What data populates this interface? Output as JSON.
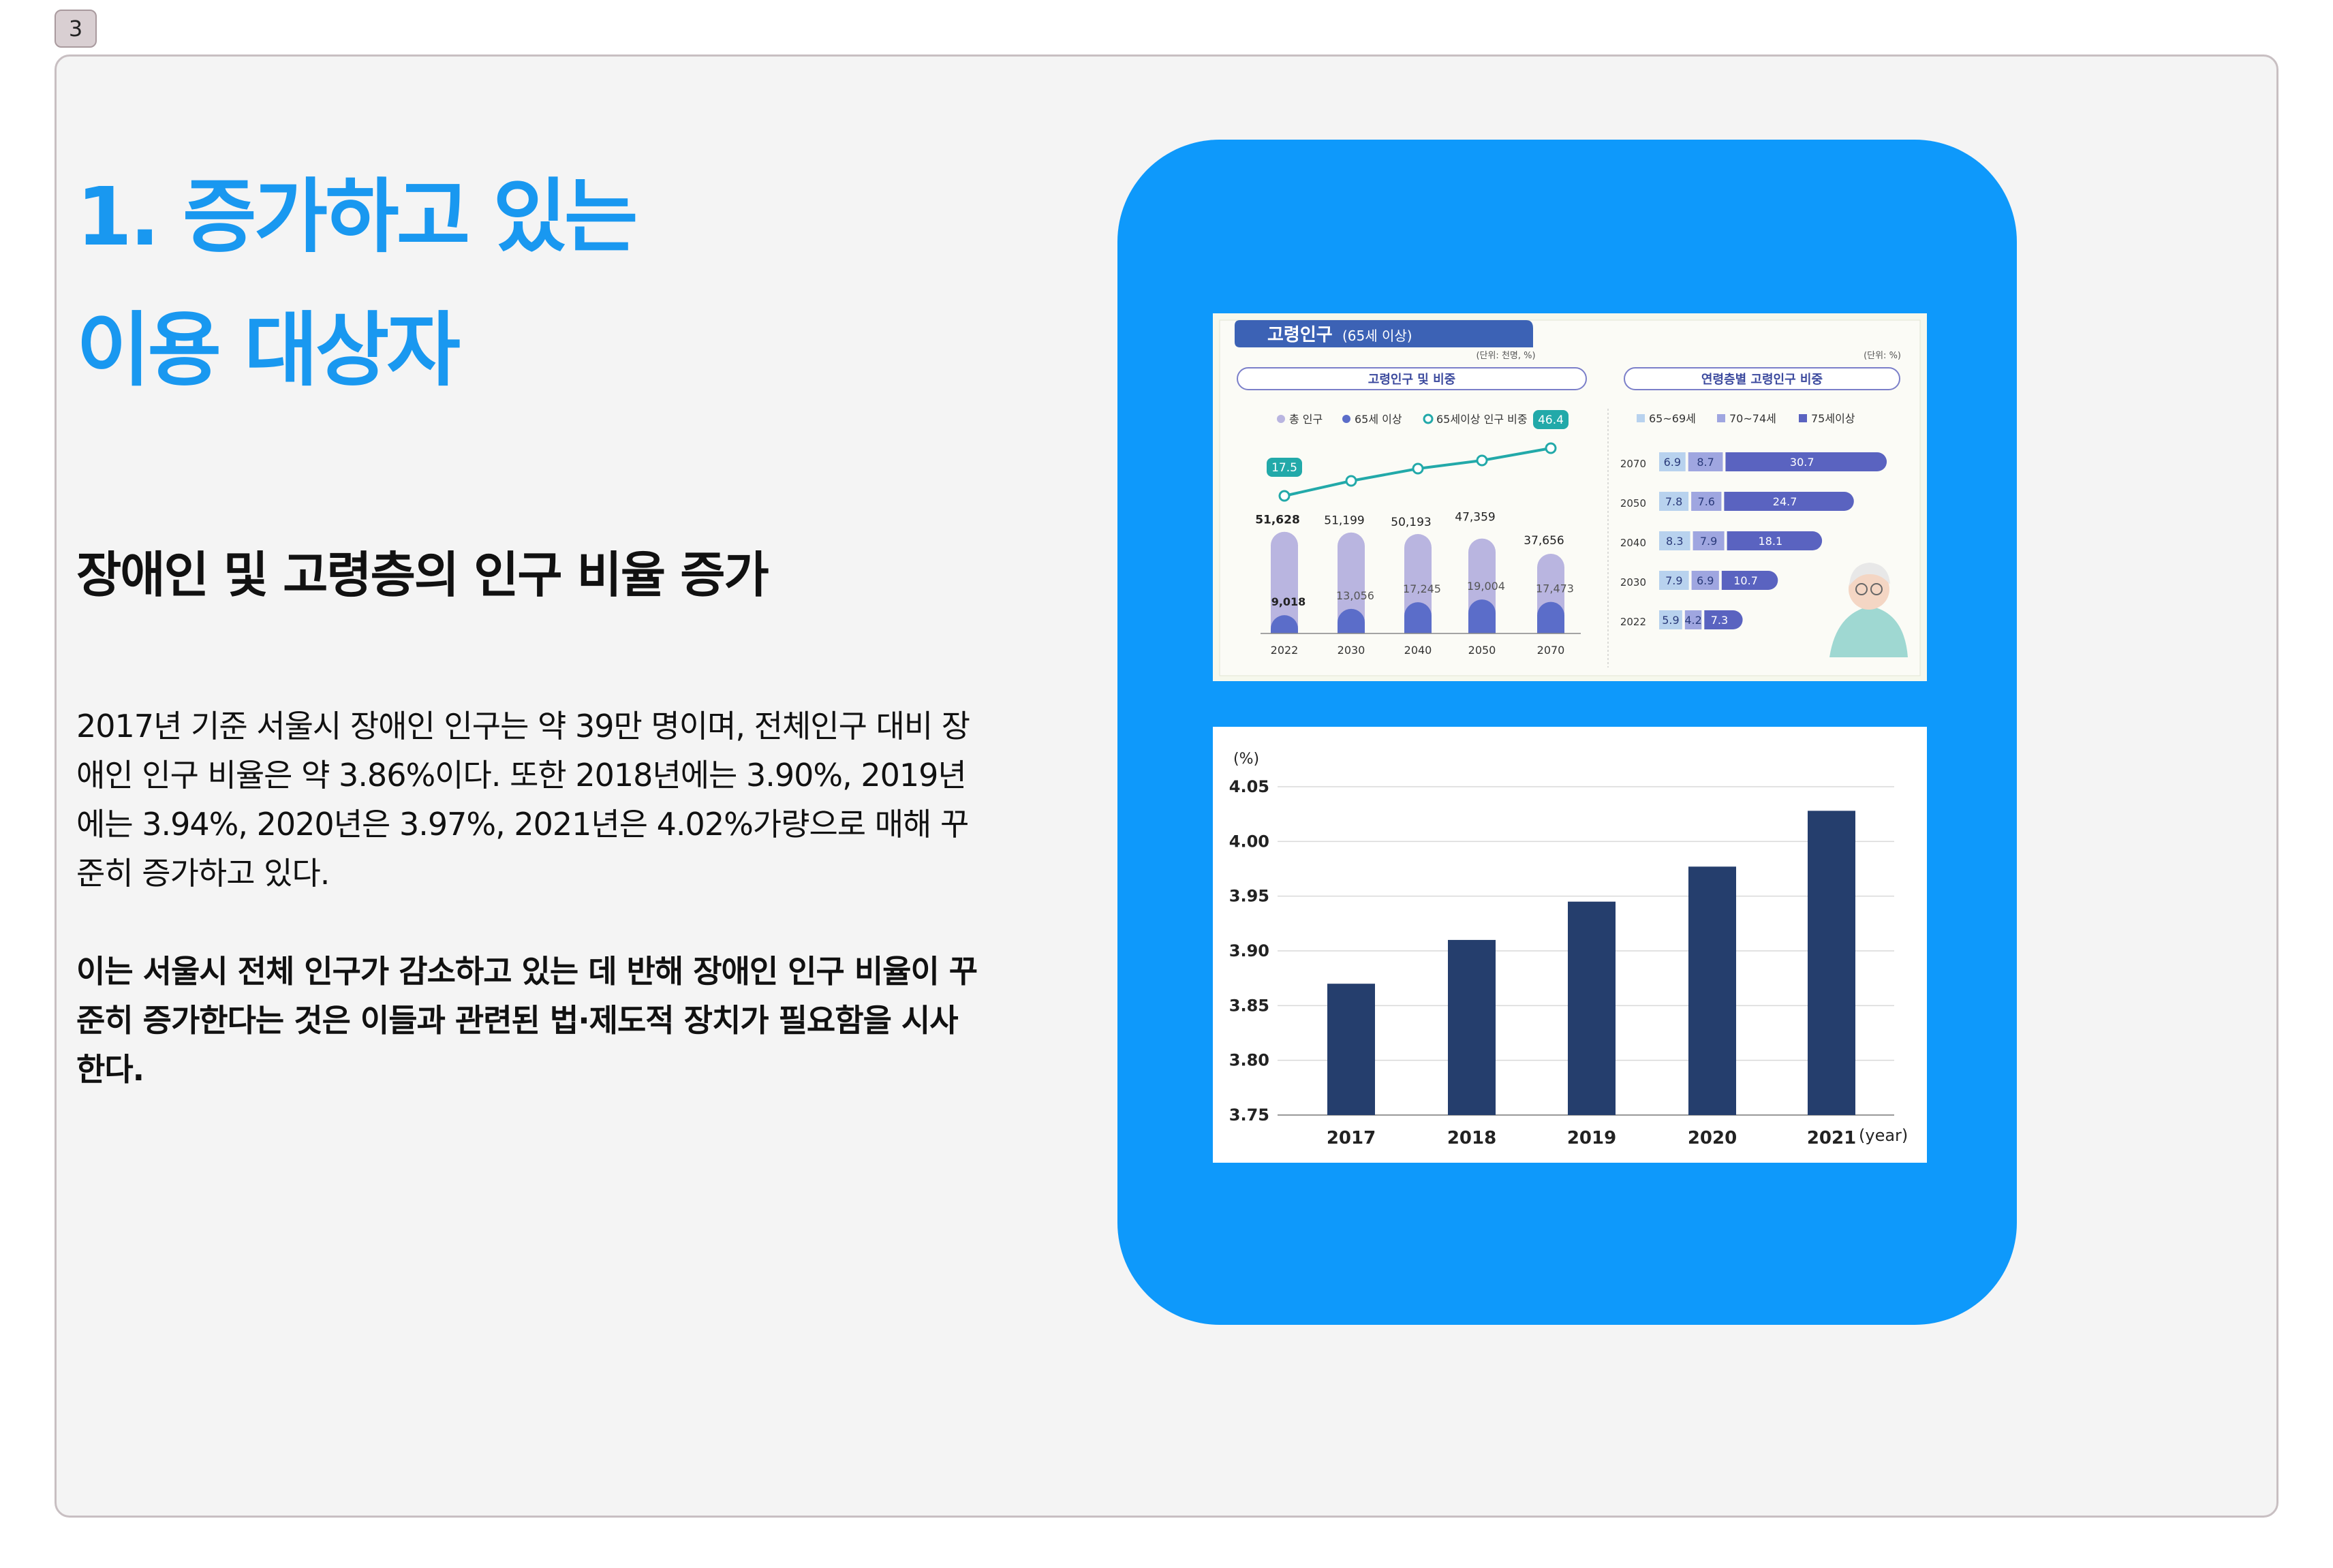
{
  "page_number": "3",
  "title_line1": "1. 증가하고 있는",
  "title_line2": "이용 대상자",
  "subtitle": "장애인 및 고령층의 인구 비율 증가",
  "paragraph1": "2017년 기준 서울시 장애인 인구는 약 39만 명이며, 전체인구 대비 장애인 인구 비율은 약 3.86%이다. 또한 2018년에는 3.90%, 2019년에는 3.94%, 2020년은 3.97%, 2021년은 4.02%가량으로 매해 꾸준히 증가하고 있다.",
  "paragraph2": "이는 서울시 전체 인구가 감소하고 있는 데 반해 장애인 인구 비율이 꾸준히 증가한다는 것은 이들과 관련된 법·제도적 장치가 필요함을 시사한다.",
  "colors": {
    "accent": "#1998f0",
    "panel": "#0e99fb",
    "bar": "#253e6d"
  },
  "chart_data": [
    {
      "type": "bar",
      "title": "고령인구",
      "title_suffix": "(65세 이상)",
      "panel_title": "고령인구 및 비중",
      "unit": "(단위: 천명, %)",
      "legend": [
        "총 인구",
        "65세 이상",
        "65세이상 인구 비중"
      ],
      "categories": [
        "2022",
        "2030",
        "2040",
        "2050",
        "2070"
      ],
      "series": [
        {
          "name": "총 인구",
          "values": [
            51628,
            51199,
            50193,
            47359,
            37656
          ],
          "labels": [
            "51,628",
            "51,199",
            "50,193",
            "47,359",
            "37,656"
          ],
          "color": "#b9b5e0"
        },
        {
          "name": "65세 이상",
          "values": [
            9018,
            13056,
            17245,
            19004,
            17473
          ],
          "labels": [
            "9,018",
            "13,056",
            "17,245",
            "19,004",
            "17,473"
          ],
          "color": "#5b6dc9"
        },
        {
          "name": "65세이상 인구 비중",
          "values": [
            17.5,
            null,
            null,
            null,
            46.4
          ],
          "labels": [
            "17.5",
            "",
            "",
            "",
            "46.4"
          ],
          "color": "#22a9a9"
        }
      ]
    },
    {
      "type": "bar",
      "panel_title": "연령층별 고령인구 비중",
      "unit": "(단위: %)",
      "orientation": "horizontal-stacked",
      "categories": [
        "2070",
        "2050",
        "2040",
        "2030",
        "2022"
      ],
      "series": [
        {
          "name": "65~69세",
          "values": [
            6.9,
            7.8,
            8.3,
            7.9,
            5.9
          ],
          "color": "#b8d2ee"
        },
        {
          "name": "70~74세",
          "values": [
            8.7,
            7.6,
            7.9,
            6.9,
            4.2
          ],
          "color": "#9fa6e0"
        },
        {
          "name": "75세이상",
          "values": [
            30.7,
            24.7,
            18.1,
            10.7,
            7.3
          ],
          "color": "#5a63c0"
        }
      ]
    },
    {
      "type": "bar",
      "ylabel": "(%)",
      "xlabel": "(year)",
      "categories": [
        "2017",
        "2018",
        "2019",
        "2020",
        "2021"
      ],
      "values": [
        3.87,
        3.91,
        3.945,
        3.977,
        4.028
      ],
      "ylim": [
        3.75,
        4.05
      ],
      "yticks": [
        "3.75",
        "3.80",
        "3.85",
        "3.90",
        "3.95",
        "4.00",
        "4.05"
      ],
      "grid": true
    }
  ]
}
